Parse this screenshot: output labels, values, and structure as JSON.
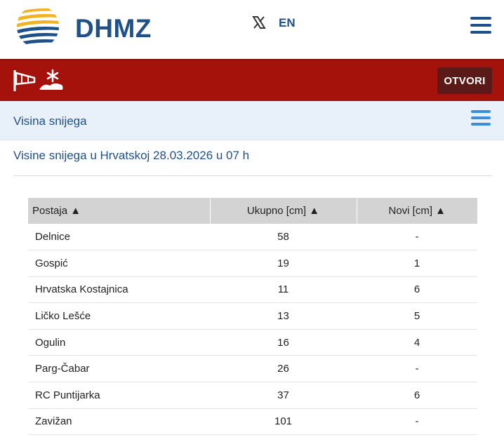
{
  "header": {
    "brand": "DHMZ",
    "lang_label": "EN",
    "icons": {
      "logo": "dhmz-logo-icon",
      "social": "x-icon",
      "menu": "hamburger-icon"
    }
  },
  "alert_bar": {
    "open_label": "OTVORI",
    "icons": [
      "windsock-icon",
      "snow-icon"
    ]
  },
  "section": {
    "title": "Visina snijega"
  },
  "page": {
    "heading": "Visine snijega u Hrvatskoj 28.03.2026 u 07 h"
  },
  "table": {
    "columns": [
      "Postaja ▲",
      "Ukupno [cm] ▲",
      "Novi [cm] ▲"
    ],
    "rows": [
      {
        "station": "Delnice",
        "total": "58",
        "new": "-"
      },
      {
        "station": "Gospić",
        "total": "19",
        "new": "1"
      },
      {
        "station": "Hrvatska Kostajnica",
        "total": "11",
        "new": "6"
      },
      {
        "station": "Ličko Lešće",
        "total": "13",
        "new": "5"
      },
      {
        "station": "Ogulin",
        "total": "16",
        "new": "4"
      },
      {
        "station": "Parg-Čabar",
        "total": "26",
        "new": "-"
      },
      {
        "station": "RC Puntijarka",
        "total": "37",
        "new": "6"
      },
      {
        "station": "Zavižan",
        "total": "101",
        "new": "-"
      }
    ]
  },
  "colors": {
    "brand_blue": "#1e5089",
    "alert_red": "#a5120c",
    "button_dark": "#5a1a18",
    "section_bg": "#e8f1fa",
    "accent_blue": "#3d8ed8"
  }
}
